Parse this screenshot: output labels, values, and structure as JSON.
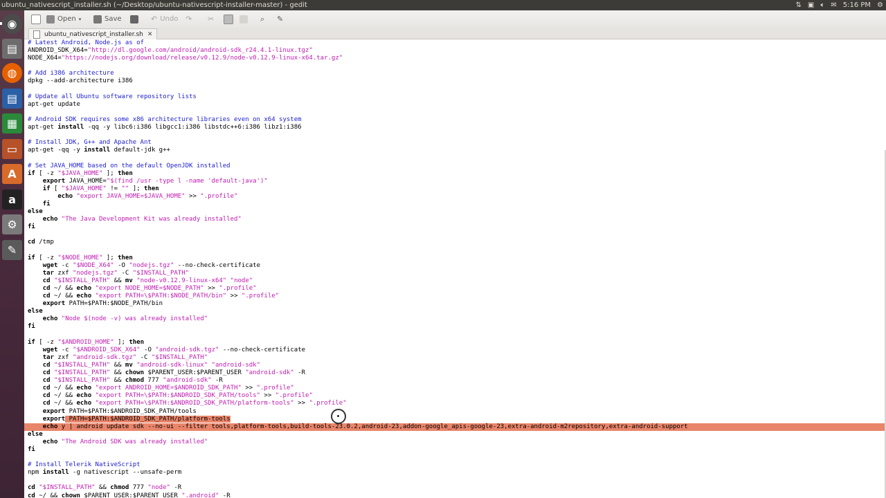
{
  "window": {
    "title": "ubuntu_nativescript_installer.sh (~/Desktop/ubuntu-nativescript-installer-master) - gedit",
    "clock": "5:16 PM",
    "tray_icons": [
      "sort-arrows-icon",
      "keyboard-icon",
      "volume-icon",
      "mail-icon"
    ]
  },
  "launcher": {
    "items": [
      "ubuntu-dash-icon",
      "file-manager-icon",
      "firefox-icon",
      "libreoffice-writer-icon",
      "libreoffice-calc-icon",
      "libreoffice-impress-icon",
      "software-center-icon",
      "amazon-icon",
      "system-settings-icon",
      "gedit-icon"
    ],
    "amazon_label": "a",
    "software_label": "A"
  },
  "toolbar": {
    "new_icon": "new-document-icon",
    "open_label": "Open",
    "save_label": "Save",
    "print_icon": "print-icon",
    "undo_label": "Undo",
    "redo_icon": "redo-icon",
    "cut_icon": "cut-icon",
    "copy_icon": "copy-icon",
    "paste_icon": "paste-icon",
    "find_icon": "find-icon",
    "replace_icon": "replace-icon"
  },
  "tab": {
    "label": "ubuntu_nativescript_installer.sh",
    "close": "✕"
  },
  "code": {
    "lines": [
      [
        [
          "c",
          "# Latest Android, Node.js as of"
        ]
      ],
      [
        [
          "v",
          "ANDROID_SDK_X64="
        ],
        [
          "s",
          "\"http://dl.google.com/android/android-sdk_r24.4.1-linux.tgz\""
        ]
      ],
      [
        [
          "v",
          "NODE_X64="
        ],
        [
          "s",
          "\"https://nodejs.org/download/release/v0.12.9/node-v0.12.9-linux-x64.tar.gz\""
        ]
      ],
      [],
      [
        [
          "c",
          "# Add i386 architecture"
        ]
      ],
      [
        [
          "v",
          "dpkg --add-architecture i386"
        ]
      ],
      [],
      [
        [
          "c",
          "# Update all Ubuntu software repository lists"
        ]
      ],
      [
        [
          "v",
          "apt-get update"
        ]
      ],
      [],
      [
        [
          "c",
          "# Android SDK requires some x86 architecture libraries even on x64 system"
        ]
      ],
      [
        [
          "v",
          "apt-get "
        ],
        [
          "k",
          "install"
        ],
        [
          "v",
          " -qq -y libc6:i386 libgcc1:i386 libstdc++6:i386 libz1:i386"
        ]
      ],
      [],
      [
        [
          "c",
          "# Install JDK, G++ and Apache Ant"
        ]
      ],
      [
        [
          "v",
          "apt-get -qq -y "
        ],
        [
          "k",
          "install"
        ],
        [
          "v",
          " default-jdk g++"
        ]
      ],
      [],
      [
        [
          "c",
          "# Set JAVA_HOME based on the default OpenJDK installed"
        ]
      ],
      [
        [
          "k",
          "if"
        ],
        [
          "v",
          " [ -z "
        ],
        [
          "s",
          "\"$JAVA_HOME\""
        ],
        [
          "v",
          " ]; "
        ],
        [
          "k",
          "then"
        ]
      ],
      [
        [
          "v",
          "    "
        ],
        [
          "k",
          "export"
        ],
        [
          "v",
          " JAVA_HOME="
        ],
        [
          "s",
          "\"$(find /usr -type l -name 'default-java')\""
        ]
      ],
      [
        [
          "v",
          "    "
        ],
        [
          "k",
          "if"
        ],
        [
          "v",
          " [ "
        ],
        [
          "s",
          "\"$JAVA_HOME\""
        ],
        [
          "v",
          " != "
        ],
        [
          "s",
          "\"\""
        ],
        [
          "v",
          " ]; "
        ],
        [
          "k",
          "then"
        ]
      ],
      [
        [
          "v",
          "        "
        ],
        [
          "k",
          "echo"
        ],
        [
          "v",
          " "
        ],
        [
          "s",
          "\"export JAVA_HOME=$JAVA_HOME\""
        ],
        [
          "v",
          " >> "
        ],
        [
          "s",
          "\".profile\""
        ]
      ],
      [
        [
          "v",
          "    "
        ],
        [
          "k",
          "fi"
        ]
      ],
      [
        [
          "k",
          "else"
        ]
      ],
      [
        [
          "v",
          "    "
        ],
        [
          "k",
          "echo"
        ],
        [
          "v",
          " "
        ],
        [
          "s",
          "\"The Java Development Kit was already installed\""
        ]
      ],
      [
        [
          "k",
          "fi"
        ]
      ],
      [],
      [
        [
          "k",
          "cd"
        ],
        [
          "v",
          " /tmp"
        ]
      ],
      [],
      [
        [
          "k",
          "if"
        ],
        [
          "v",
          " [ -z "
        ],
        [
          "s",
          "\"$NODE_HOME\""
        ],
        [
          "v",
          " ]; "
        ],
        [
          "k",
          "then"
        ]
      ],
      [
        [
          "v",
          "    "
        ],
        [
          "k",
          "wget"
        ],
        [
          "v",
          " -c "
        ],
        [
          "s",
          "\"$NODE_X64\""
        ],
        [
          "v",
          " -O "
        ],
        [
          "s",
          "\"nodejs.tgz\""
        ],
        [
          "v",
          " --no-check-certificate"
        ]
      ],
      [
        [
          "v",
          "    "
        ],
        [
          "k",
          "tar"
        ],
        [
          "v",
          " zxf "
        ],
        [
          "s",
          "\"nodejs.tgz\""
        ],
        [
          "v",
          " -C "
        ],
        [
          "s",
          "\"$INSTALL_PATH\""
        ]
      ],
      [
        [
          "v",
          "    "
        ],
        [
          "k",
          "cd"
        ],
        [
          "v",
          " "
        ],
        [
          "s",
          "\"$INSTALL_PATH\""
        ],
        [
          "v",
          " && "
        ],
        [
          "k",
          "mv"
        ],
        [
          "v",
          " "
        ],
        [
          "s",
          "\"node-v0.12.9-linux-x64\""
        ],
        [
          "v",
          " "
        ],
        [
          "s",
          "\"node\""
        ]
      ],
      [
        [
          "v",
          "    "
        ],
        [
          "k",
          "cd"
        ],
        [
          "v",
          " ~/ && "
        ],
        [
          "k",
          "echo"
        ],
        [
          "v",
          " "
        ],
        [
          "s",
          "\"export NODE_HOME=$NODE_PATH\""
        ],
        [
          "v",
          " >> "
        ],
        [
          "s",
          "\".profile\""
        ]
      ],
      [
        [
          "v",
          "    "
        ],
        [
          "k",
          "cd"
        ],
        [
          "v",
          " ~/ && "
        ],
        [
          "k",
          "echo"
        ],
        [
          "v",
          " "
        ],
        [
          "s",
          "\"export PATH=\\$PATH:$NODE_PATH/bin\""
        ],
        [
          "v",
          " >> "
        ],
        [
          "s",
          "\".profile\""
        ]
      ],
      [
        [
          "v",
          "    "
        ],
        [
          "k",
          "export"
        ],
        [
          "v",
          " PATH=$PATH:$NODE_PATH/bin"
        ]
      ],
      [
        [
          "k",
          "else"
        ]
      ],
      [
        [
          "v",
          "    "
        ],
        [
          "k",
          "echo"
        ],
        [
          "v",
          " "
        ],
        [
          "s",
          "\"Node $(node -v) was already installed\""
        ]
      ],
      [
        [
          "k",
          "fi"
        ]
      ],
      [],
      [
        [
          "k",
          "if"
        ],
        [
          "v",
          " [ -z "
        ],
        [
          "s",
          "\"$ANDROID_HOME\""
        ],
        [
          "v",
          " ]; "
        ],
        [
          "k",
          "then"
        ]
      ],
      [
        [
          "v",
          "    "
        ],
        [
          "k",
          "wget"
        ],
        [
          "v",
          " -c "
        ],
        [
          "s",
          "\"$ANDROID_SDK_X64\""
        ],
        [
          "v",
          " -O "
        ],
        [
          "s",
          "\"android-sdk.tgz\""
        ],
        [
          "v",
          " --no-check-certificate"
        ]
      ],
      [
        [
          "v",
          "    "
        ],
        [
          "k",
          "tar"
        ],
        [
          "v",
          " zxf "
        ],
        [
          "s",
          "\"android-sdk.tgz\""
        ],
        [
          "v",
          " -C "
        ],
        [
          "s",
          "\"$INSTALL_PATH\""
        ]
      ],
      [
        [
          "v",
          "    "
        ],
        [
          "k",
          "cd"
        ],
        [
          "v",
          " "
        ],
        [
          "s",
          "\"$INSTALL_PATH\""
        ],
        [
          "v",
          " && "
        ],
        [
          "k",
          "mv"
        ],
        [
          "v",
          " "
        ],
        [
          "s",
          "\"android-sdk-linux\""
        ],
        [
          "v",
          " "
        ],
        [
          "s",
          "\"android-sdk\""
        ]
      ],
      [
        [
          "v",
          "    "
        ],
        [
          "k",
          "cd"
        ],
        [
          "v",
          " "
        ],
        [
          "s",
          "\"$INSTALL_PATH\""
        ],
        [
          "v",
          " && "
        ],
        [
          "k",
          "chown"
        ],
        [
          "v",
          " $PARENT_USER:$PARENT_USER "
        ],
        [
          "s",
          "\"android-sdk\""
        ],
        [
          "v",
          " -R"
        ]
      ],
      [
        [
          "v",
          "    "
        ],
        [
          "k",
          "cd"
        ],
        [
          "v",
          " "
        ],
        [
          "s",
          "\"$INSTALL_PATH\""
        ],
        [
          "v",
          " && "
        ],
        [
          "k",
          "chmod"
        ],
        [
          "v",
          " 777 "
        ],
        [
          "s",
          "\"android-sdk\""
        ],
        [
          "v",
          " -R"
        ]
      ],
      [
        [
          "v",
          "    "
        ],
        [
          "k",
          "cd"
        ],
        [
          "v",
          " ~/ && "
        ],
        [
          "k",
          "echo"
        ],
        [
          "v",
          " "
        ],
        [
          "s",
          "\"export ANDROID_HOME=$ANDROID_SDK_PATH\""
        ],
        [
          "v",
          " >> "
        ],
        [
          "s",
          "\".profile\""
        ]
      ],
      [
        [
          "v",
          "    "
        ],
        [
          "k",
          "cd"
        ],
        [
          "v",
          " ~/ && "
        ],
        [
          "k",
          "echo"
        ],
        [
          "v",
          " "
        ],
        [
          "s",
          "\"export PATH=\\$PATH:$ANDROID_SDK_PATH/tools\""
        ],
        [
          "v",
          " >> "
        ],
        [
          "s",
          "\".profile\""
        ]
      ],
      [
        [
          "v",
          "    "
        ],
        [
          "k",
          "cd"
        ],
        [
          "v",
          " ~/ && "
        ],
        [
          "k",
          "echo"
        ],
        [
          "v",
          " "
        ],
        [
          "s",
          "\"export PATH=\\$PATH:$ANDROID_SDK_PATH/platform-tools\""
        ],
        [
          "v",
          " >> "
        ],
        [
          "s",
          "\".profile\""
        ]
      ],
      [
        [
          "v",
          "    "
        ],
        [
          "k",
          "export"
        ],
        [
          "v",
          " PATH=$PATH:$ANDROID_SDK_PATH/tools"
        ]
      ],
      [
        [
          "v",
          "    "
        ],
        [
          "k",
          "export"
        ],
        [
          "v",
          " PATH=$PATH:$ANDROID_SDK_PATH/platform-tools"
        ]
      ],
      [
        [
          "v",
          "    "
        ],
        [
          "k",
          "echo"
        ],
        [
          "v",
          " y | android update sdk --no-ui --filter tools,platform-tools,build-tools-23.0.2,android-23,addon-google_apis-google-23,extra-android-m2repository,extra-android-support"
        ]
      ],
      [
        [
          "k",
          "else"
        ]
      ],
      [
        [
          "v",
          "    "
        ],
        [
          "k",
          "echo"
        ],
        [
          "v",
          " "
        ],
        [
          "s",
          "\"The Android SDK was already installed\""
        ]
      ],
      [
        [
          "k",
          "fi"
        ]
      ],
      [],
      [
        [
          "c",
          "# Install Telerik NativeScript"
        ]
      ],
      [
        [
          "v",
          "npm "
        ],
        [
          "k",
          "install"
        ],
        [
          "v",
          " -g nativescript --unsafe-perm"
        ]
      ],
      [],
      [
        [
          "k",
          "cd"
        ],
        [
          "v",
          " "
        ],
        [
          "s",
          "\"$INSTALL_PATH\""
        ],
        [
          "v",
          " && "
        ],
        [
          "k",
          "chmod"
        ],
        [
          "v",
          " 777 "
        ],
        [
          "s",
          "\"node\""
        ],
        [
          "v",
          " -R"
        ]
      ],
      [
        [
          "k",
          "cd"
        ],
        [
          "v",
          " ~/ && "
        ],
        [
          "k",
          "chown"
        ],
        [
          "v",
          " $PARENT_USER:$PARENT_USER "
        ],
        [
          "s",
          "\".android\""
        ],
        [
          "v",
          " -R"
        ]
      ]
    ],
    "selected_full_line": 50,
    "selected_tail_line": 49,
    "selected_tail_from_segment": 2
  }
}
